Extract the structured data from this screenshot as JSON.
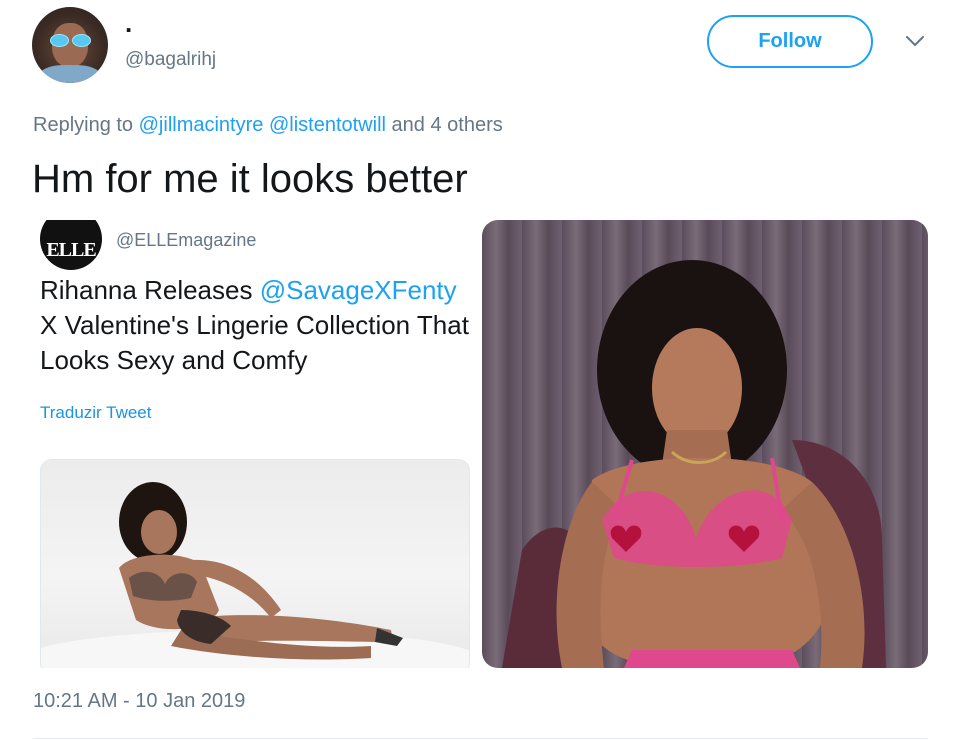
{
  "author": {
    "display_name": ".",
    "handle": "@bagalrihj",
    "follow_label": "Follow"
  },
  "reply_context": {
    "prefix": "Replying to",
    "mention_1": "@jillmacintyre",
    "mention_2": "@listentotwill",
    "suffix": "and 4 others"
  },
  "tweet": {
    "text": "Hm for me it looks better",
    "timestamp": "10:21 AM - 10 Jan 2019"
  },
  "embedded_tweet": {
    "logo_text": "ELLE",
    "handle": "@ELLEmagazine",
    "text_before": "Rihanna Releases ",
    "mention": "@SavageXFenty",
    "text_after": " X Valentine's Lingerie Collection That Looks Sexy and Comfy",
    "translate_label": "Traduzir Tweet"
  },
  "colors": {
    "accent": "#1da1f2",
    "secondary_text": "#657786",
    "primary_text": "#14171a"
  },
  "icons": {
    "more_menu": "chevron-down-icon"
  }
}
